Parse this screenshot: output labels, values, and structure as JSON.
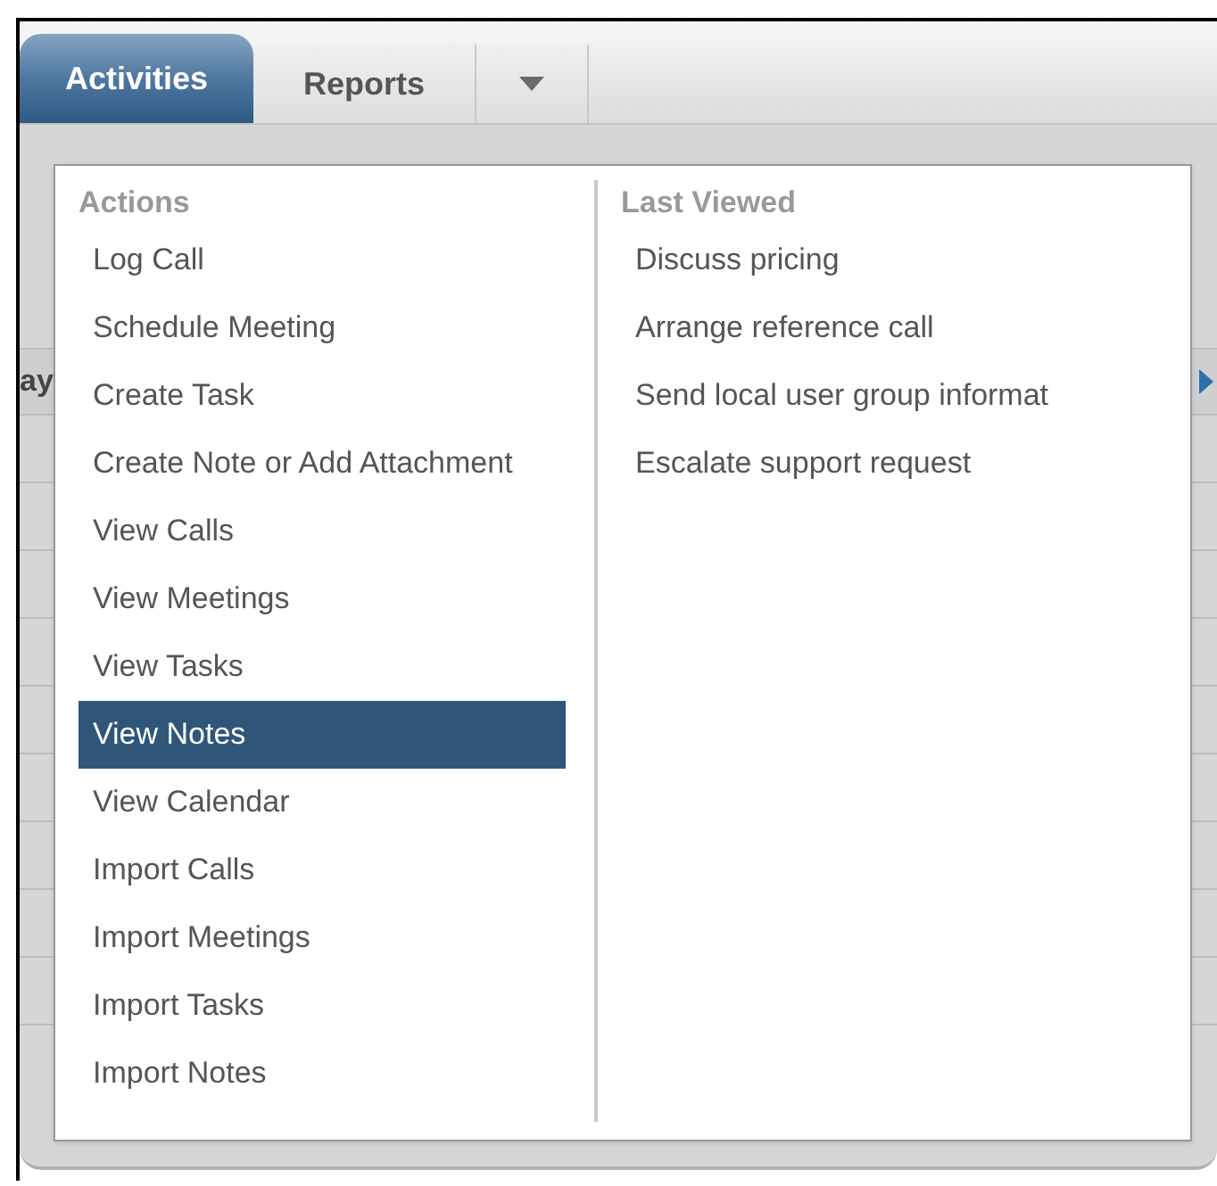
{
  "tabs": [
    {
      "label": "Activities",
      "selected": true
    },
    {
      "label": "Reports",
      "selected": false
    },
    {
      "kind": "menu",
      "selected": false
    }
  ],
  "background": {
    "column_header_fragment": "ay"
  },
  "menu": {
    "actions": {
      "heading": "Actions",
      "items": [
        {
          "label": "Log Call",
          "selected": false
        },
        {
          "label": "Schedule Meeting",
          "selected": false
        },
        {
          "label": "Create Task",
          "selected": false
        },
        {
          "label": "Create Note or Add Attachment",
          "selected": false
        },
        {
          "label": "View Calls",
          "selected": false
        },
        {
          "label": "View Meetings",
          "selected": false
        },
        {
          "label": "View Tasks",
          "selected": false
        },
        {
          "label": "View Notes",
          "selected": true
        },
        {
          "label": "View Calendar",
          "selected": false
        },
        {
          "label": "Import Calls",
          "selected": false
        },
        {
          "label": "Import Meetings",
          "selected": false
        },
        {
          "label": "Import Tasks",
          "selected": false
        },
        {
          "label": "Import Notes",
          "selected": false
        }
      ]
    },
    "last_viewed": {
      "heading": "Last Viewed",
      "items": [
        {
          "label": "Discuss pricing"
        },
        {
          "label": "Arrange reference call"
        },
        {
          "label": "Send local user group informat"
        },
        {
          "label": "Escalate support request"
        }
      ]
    }
  }
}
